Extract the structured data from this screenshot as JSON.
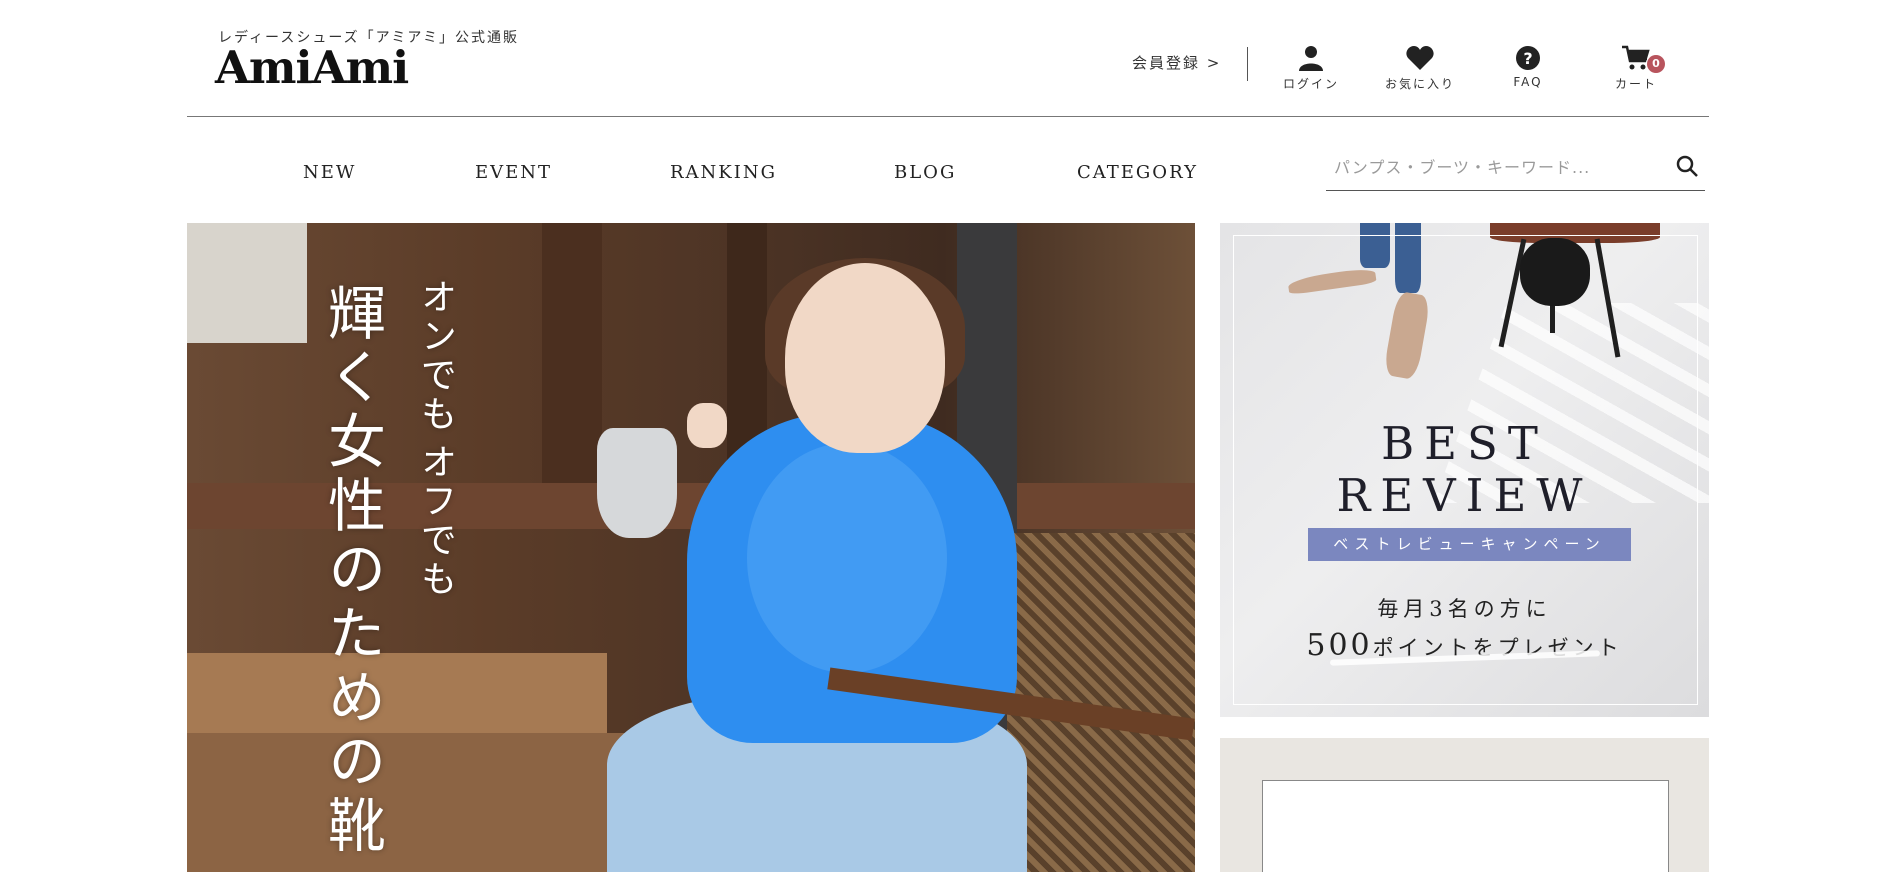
{
  "header": {
    "tagline": "レディースシューズ「アミアミ」公式通販",
    "logo": "AmiAmi",
    "register": "会員登録 >",
    "icons": [
      {
        "icon": "person-icon",
        "label": "ログイン"
      },
      {
        "icon": "heart-icon",
        "label": "お気に入り"
      },
      {
        "icon": "question-icon",
        "label": "FAQ"
      },
      {
        "icon": "cart-icon",
        "label": "カート",
        "badge": "0"
      }
    ]
  },
  "nav": {
    "items": [
      "NEW",
      "EVENT",
      "RANKING",
      "BLOG",
      "CATEGORY"
    ],
    "search_placeholder": "パンプス・ブーツ・キーワード..."
  },
  "hero": {
    "headline": "輝く女性のための靴",
    "sub1": "オンでも",
    "sub2": "オフでも"
  },
  "review_banner": {
    "title_line1": "BEST",
    "title_line2": "REVIEW",
    "pill": "ベストレビューキャンペーン",
    "line1": "毎月3名の方に",
    "line2_num": "500",
    "line2_text": "ポイントをプレゼント"
  },
  "colors": {
    "badge": "#b8545d",
    "pill": "#7b87bf",
    "sweater": "#2e8ef0"
  }
}
